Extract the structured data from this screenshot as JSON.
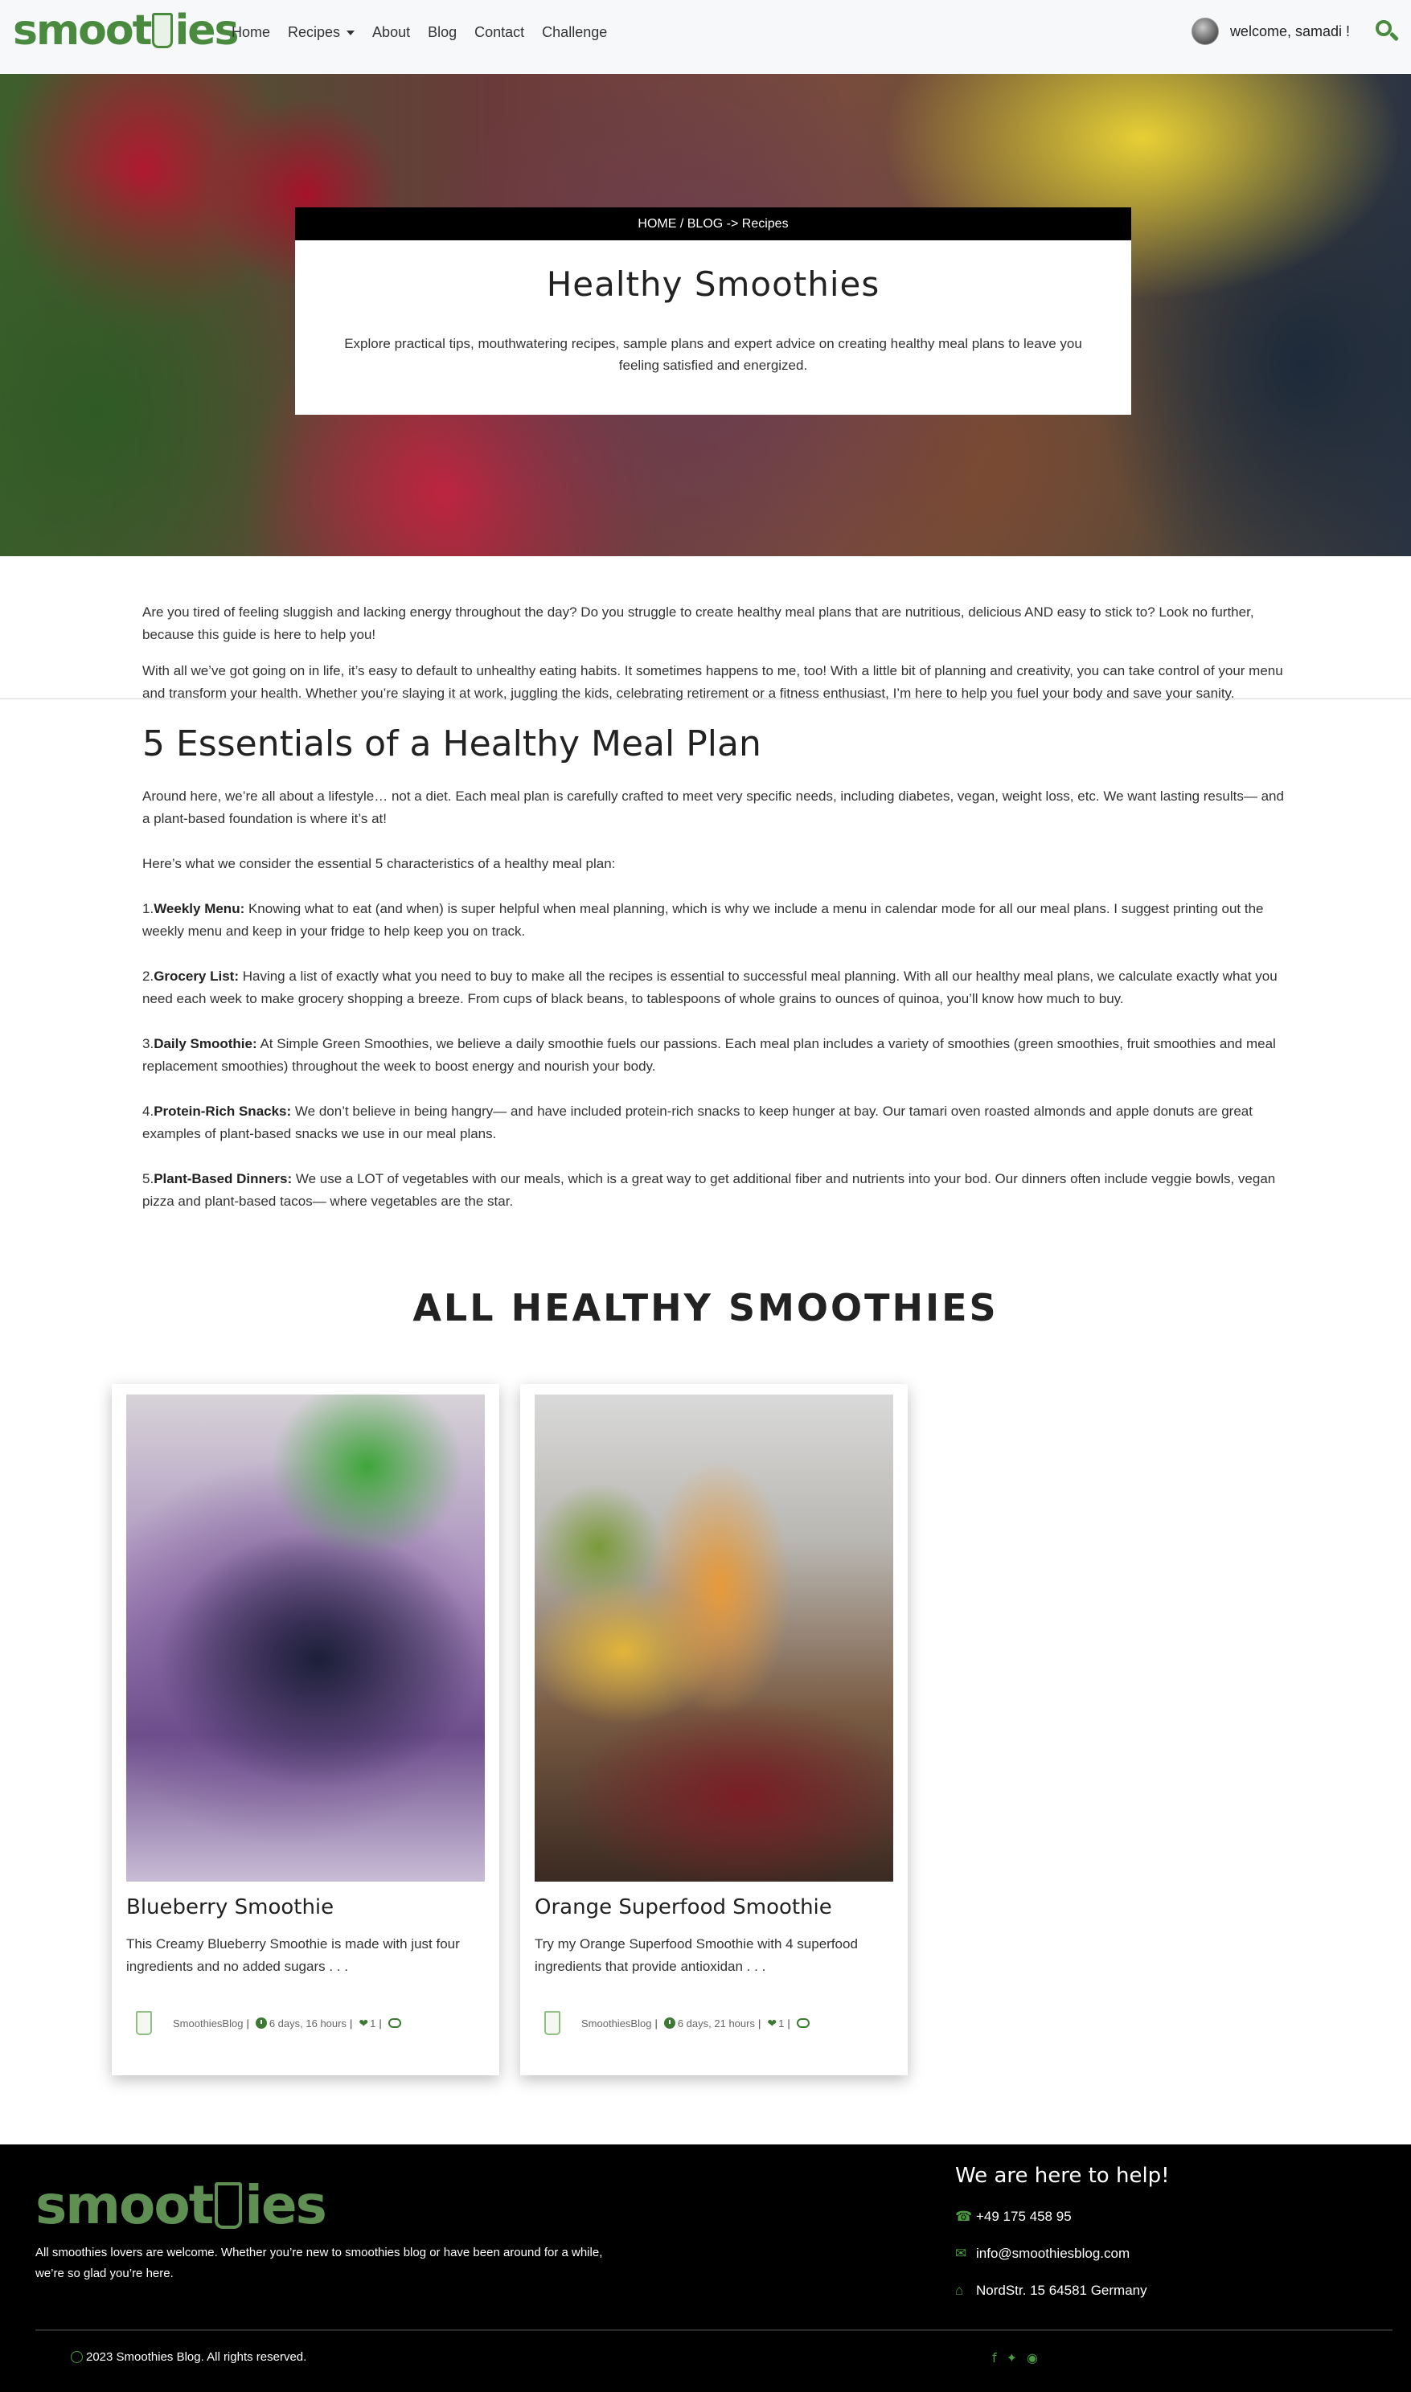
{
  "navbar": {
    "logo_left": "smoot",
    "logo_right": "ies",
    "links": {
      "home": "Home",
      "recipes": "Recipes",
      "about": "About",
      "blog": "Blog",
      "contact": "Contact",
      "challenge": "Challenge"
    },
    "welcome": "welcome, samadi !"
  },
  "hero": {
    "breadcrumb": "HOME / BLOG -> Recipes",
    "title": "Healthy Smoothies",
    "subtitle": "Explore practical tips, mouthwatering recipes, sample plans and expert advice on creating healthy meal plans to leave you feeling satisfied and energized."
  },
  "article": {
    "intro1": "Are you tired of feeling sluggish and lacking energy throughout the day? Do you struggle to create healthy meal plans that are nutritious, delicious AND easy to stick to? Look no further, because this guide is here to help you!",
    "intro2": "With all we’ve got going on in life, it’s easy to default to unhealthy eating habits. It sometimes happens to me, too! With a little bit of planning and creativity, you can take control of your menu and transform your health. Whether you’re slaying it at work, juggling the kids, celebrating retirement or a fitness enthusiast, I’m here to help you fuel your body and save your sanity.",
    "heading": "5 Essentials of a Healthy Meal Plan",
    "lifestyle": "Around here, we’re all about a lifestyle… not a diet. Each meal plan is carefully crafted to meet very specific needs, including diabetes, vegan, weight loss, etc. We want lasting results— and a plant-based foundation is where it’s at!",
    "lead": "Here’s what we consider the essential 5 characteristics of a healthy meal plan:",
    "items": [
      {
        "num": "1.",
        "label": "Weekly Menu:",
        "text": " Knowing what to eat (and when) is super helpful when meal planning, which is why we include a menu in calendar mode for all our meal plans. I suggest printing out the weekly menu and keep in your fridge to help keep you on track."
      },
      {
        "num": "2.",
        "label": "Grocery List:",
        "text": " Having a list of exactly what you need to buy to make all the recipes is essential to successful meal planning. With all our healthy meal plans, we calculate exactly what you need each week to make grocery shopping a breeze. From cups of black beans, to tablespoons of whole grains to ounces of quinoa, you’ll know how much to buy."
      },
      {
        "num": "3.",
        "label": "Daily Smoothie:",
        "text": " At Simple Green Smoothies, we believe a daily smoothie fuels our passions. Each meal plan includes a variety of smoothies (green smoothies, fruit smoothies and meal replacement smoothies) throughout the week to boost energy and nourish your body."
      },
      {
        "num": "4.",
        "label": "Protein-Rich Snacks:",
        "text": " We don’t believe in being hangry— and have included protein-rich snacks to keep hunger at bay. Our tamari oven roasted almonds and apple donuts are great examples of plant-based snacks we use in our meal plans."
      },
      {
        "num": "5.",
        "label": "Plant-Based Dinners:",
        "text": " We use a LOT of vegetables with our meals, which is a great way to get additional fiber and nutrients into your bod. Our dinners often include veggie bowls, vegan pizza and plant-based tacos— where vegetables are the star."
      }
    ]
  },
  "all_title": "ALL HEALTHY SMOOTHIES",
  "cards": [
    {
      "title": "Blueberry Smoothie",
      "desc": "This Creamy Blueberry Smoothie is made with just four ingredients and no added sugars . . .",
      "author": "SmoothiesBlog",
      "time": "6 days, 16 hours",
      "likes": "1"
    },
    {
      "title": "Orange Superfood Smoothie",
      "desc": "Try my Orange Superfood Smoothie with 4 superfood ingredients that provide antioxidan . . .",
      "author": "SmoothiesBlog",
      "time": "6 days, 21 hours",
      "likes": "1"
    }
  ],
  "footer": {
    "logo_left": "smoot",
    "logo_right": "ies",
    "description": "All smoothies lovers are welcome. Whether you’re new to smoothies blog or have been around for a while, we’re so glad you’re here.",
    "help_title": "We are here to help!",
    "phone": "+49 175 458 95",
    "email": "info@smoothiesblog.com",
    "address": "NordStr. 15 64581 Germany",
    "copyright": "2023 Smoothies Blog. All rights reserved."
  },
  "colors": {
    "brand_green": "#4a8a3f",
    "footer_bg": "#000000",
    "hero_card_header": "#000000"
  },
  "icons": [
    "search-icon",
    "chevron-down-icon",
    "clock-icon",
    "heart-icon",
    "comment-icon",
    "phone-icon",
    "mail-icon",
    "home-icon",
    "copyright-icon",
    "facebook-icon",
    "twitter-icon",
    "instagram-icon"
  ]
}
